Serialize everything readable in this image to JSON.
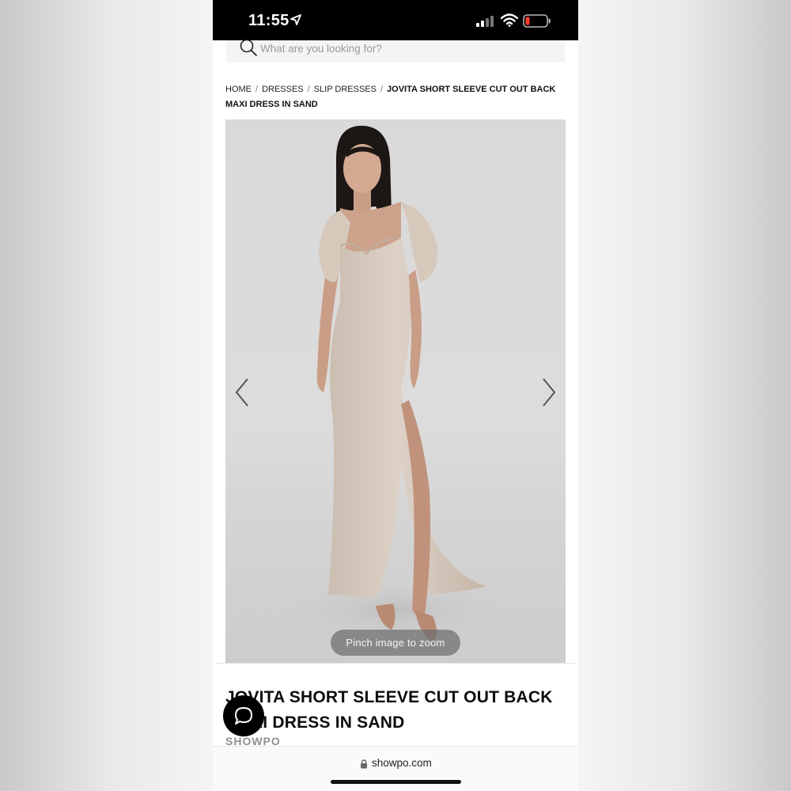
{
  "status_bar": {
    "time": "11:55",
    "icons": [
      "location-arrow-icon",
      "cellular-signal-icon",
      "wifi-icon",
      "battery-low-icon"
    ],
    "battery_color": "#ff3b30"
  },
  "search": {
    "placeholder": "What are you looking for?",
    "icon": "search-icon"
  },
  "breadcrumb": {
    "items": [
      "HOME",
      "DRESSES",
      "SLIP DRESSES"
    ],
    "separator": "/",
    "current": "JOVITA SHORT SLEEVE CUT OUT BACK MAXI DRESS IN SAND"
  },
  "gallery": {
    "prev_icon": "chevron-left-icon",
    "next_icon": "chevron-right-icon",
    "zoom_hint": "Pinch image to zoom"
  },
  "product": {
    "title": "JOVITA SHORT SLEEVE CUT OUT BACK MAXI DRESS IN SAND",
    "brand": "SHOWPO"
  },
  "chat": {
    "icon": "chat-bubble-icon"
  },
  "browser": {
    "url": "showpo.com",
    "lock_icon": "lock-icon"
  },
  "colors": {
    "dress": "#d8cbbe",
    "background": "#dcdcdc"
  }
}
